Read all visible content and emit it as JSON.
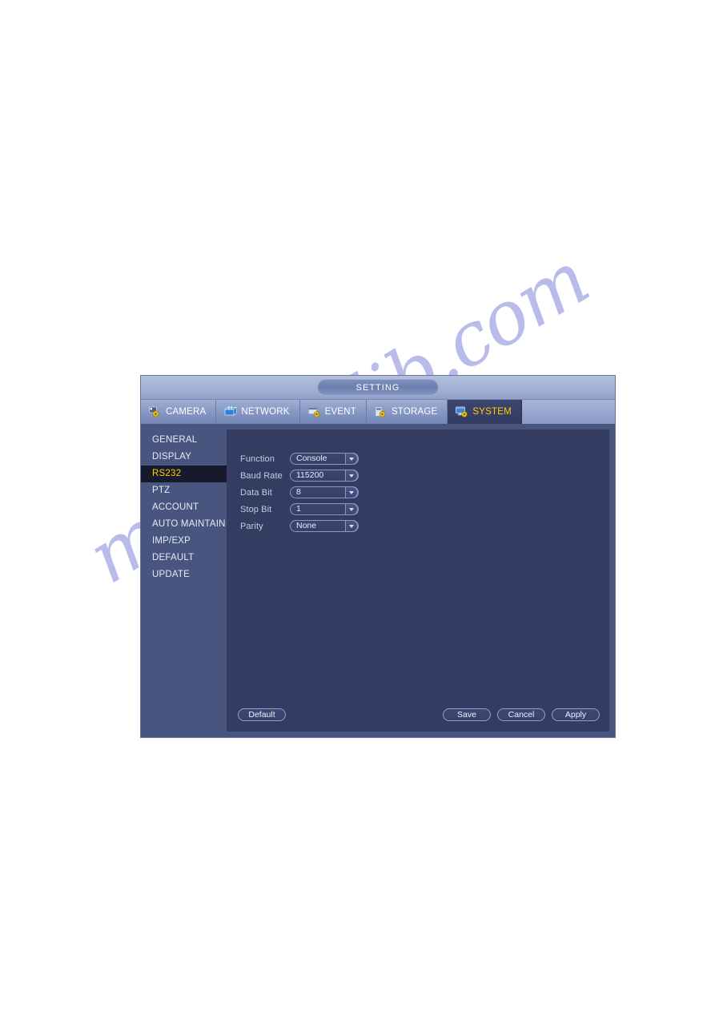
{
  "watermark": {
    "text": "manualslib.com"
  },
  "window": {
    "title": "SETTING",
    "tabs": [
      {
        "label": "CAMERA",
        "icon": "camera-gear-icon",
        "active": false
      },
      {
        "label": "NETWORK",
        "icon": "network-icon",
        "active": false
      },
      {
        "label": "EVENT",
        "icon": "event-gear-icon",
        "active": false
      },
      {
        "label": "STORAGE",
        "icon": "storage-gear-icon",
        "active": false
      },
      {
        "label": "SYSTEM",
        "icon": "system-gear-icon",
        "active": true
      }
    ],
    "sidebar": {
      "items": [
        {
          "label": "GENERAL",
          "selected": false
        },
        {
          "label": "DISPLAY",
          "selected": false
        },
        {
          "label": "RS232",
          "selected": true
        },
        {
          "label": "PTZ",
          "selected": false
        },
        {
          "label": "ACCOUNT",
          "selected": false
        },
        {
          "label": "AUTO MAINTAIN",
          "selected": false
        },
        {
          "label": "IMP/EXP",
          "selected": false
        },
        {
          "label": "DEFAULT",
          "selected": false
        },
        {
          "label": "UPDATE",
          "selected": false
        }
      ]
    },
    "form": {
      "fields": [
        {
          "label": "Function",
          "value": "Console"
        },
        {
          "label": "Baud Rate",
          "value": "115200"
        },
        {
          "label": "Data Bit",
          "value": "8"
        },
        {
          "label": "Stop Bit",
          "value": "1"
        },
        {
          "label": "Parity",
          "value": "None"
        }
      ]
    },
    "buttons": {
      "default_label": "Default",
      "save_label": "Save",
      "cancel_label": "Cancel",
      "apply_label": "Apply"
    },
    "colors": {
      "accent_yellow": "#ffd100",
      "panel_bg": "#343c62",
      "sidebar_bg": "#47557f",
      "titlebar_top": "#b3c0dd",
      "selected_item_bg": "#161a2d"
    }
  }
}
